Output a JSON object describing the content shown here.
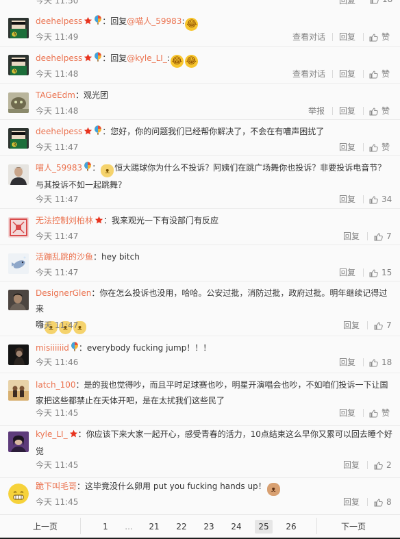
{
  "top_partial": {
    "time": "今天 11:50",
    "reply": "回复",
    "like_count": "18"
  },
  "comments": [
    {
      "user": "deehelpess",
      "sep": "：",
      "reply_prefix": "回复",
      "at": "@喵人_59983",
      "colon": ":",
      "text": "",
      "time": "今天 11:49",
      "view_conv": "查看对话",
      "reply": "回复",
      "like": "赞"
    },
    {
      "user": "deehelpess",
      "sep": "：",
      "reply_prefix": "回复",
      "at": "@kyle_LI_",
      "colon": ":",
      "text": "",
      "time": "今天 11:48",
      "view_conv": "查看对话",
      "reply": "回复",
      "like": "赞"
    },
    {
      "user": "TAGeEdm",
      "sep": "：",
      "text": "观光团",
      "time": "今天 11:48",
      "report": "举报",
      "reply": "回复",
      "like": "赞"
    },
    {
      "user": "deehelpess",
      "sep": "：",
      "text": "您好，你的问题我们已经帮你解决了，不会在有嘈声困扰了",
      "time": "今天 11:47",
      "reply": "回复",
      "like": "赞"
    },
    {
      "user": "喵人_59983",
      "sep": "：",
      "text": "恒大踢球你为什么不投诉？阿姨们在跳广场舞你也投诉？非要投诉电音节？",
      "text2": "与其投诉不如一起跳舞？",
      "time": "今天 11:47",
      "reply": "回复",
      "like": "34"
    },
    {
      "user": "无法控制刘柏林",
      "sep": "：",
      "text": "我来观光一下有没部门有反应",
      "time": "今天 11:47",
      "reply": "回复",
      "like": "7"
    },
    {
      "user": "活蹦乱跳的沙鱼",
      "sep": "：",
      "text": "hey bitch",
      "time": "今天 11:47",
      "reply": "回复",
      "like": "15"
    },
    {
      "user": "DesignerGlen",
      "sep": "：",
      "text": "你在怎么投诉也没用，哈哈。公安过批，消防过批，政府过批。明年继续记得过来",
      "text2": "嗨",
      "time": "今天 11:47",
      "reply": "回复",
      "like": "7"
    },
    {
      "user": "misiiiiiid",
      "sep": "：",
      "text": "everybody fucking jump！！！",
      "time": "今天 11:46",
      "reply": "回复",
      "like": "18"
    },
    {
      "user": "latch_100",
      "sep": "：",
      "text": "是的我也觉得吵，而且平时足球赛也吵，明星开演唱会也吵，不如咱们投诉一下让国",
      "text2": "家把这些都禁止在天体开吧，是在太扰我们这些民了",
      "time": "今天 11:45",
      "reply": "回复",
      "like": "赞"
    },
    {
      "user": "kyle_LI_",
      "sep": "：",
      "text": "你应该下来大家一起开心，感受青春的活力，10点结束这么早你又累可以回去睡个好",
      "text2": "觉",
      "time": "今天 11:45",
      "reply": "回复",
      "like": "2"
    },
    {
      "user": "跪下叫毛哥",
      "sep": "：",
      "text": "这毕竟没什么卵用 put you fucking hands up！",
      "time": "今天 11:45",
      "reply": "回复",
      "like": "8"
    }
  ],
  "pager": {
    "prev": "上一页",
    "p1": "1",
    "ellipsis": "...",
    "p21": "21",
    "p22": "22",
    "p23": "23",
    "p24": "24",
    "p25": "25",
    "p26": "26",
    "next": "下一页"
  }
}
